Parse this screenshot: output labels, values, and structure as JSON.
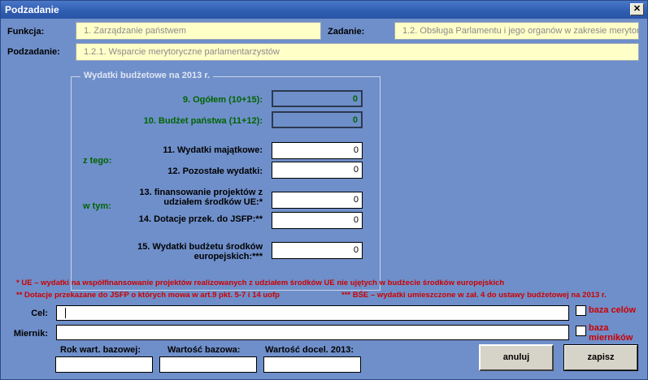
{
  "window": {
    "title": "Podzadanie",
    "close_glyph": "✕"
  },
  "header": {
    "funkcja_label": "Funkcja:",
    "funkcja_value": "1. Zarządzanie państwem",
    "zadanie_label": "Zadanie:",
    "zadanie_value": "1.2. Obsługa Parlamentu i jego organów w zakresie merytor",
    "podzadanie_label": "Podzadanie:",
    "podzadanie_value": "1.2.1. Wsparcie merytoryczne parlamentarzystów"
  },
  "expenses": {
    "frame_title": "Wydatki budżetowe na 2013 r.",
    "ogolem_label": "9. Ogółem (10+15):",
    "ogolem_value": "0",
    "budzet_label": "10. Budżet państwa (11+12):",
    "budzet_value": "0",
    "z_tego_label": "z tego:",
    "majatkowe_label": "11. Wydatki majątkowe:",
    "majatkowe_value": "0",
    "pozostale_label": "12. Pozostałe wydatki:",
    "pozostale_value": "0",
    "w_tym_label": "w tym:",
    "ue_label_1": "13. finansowanie projektów z",
    "ue_label_2": "udziałem środków UE:*",
    "ue_value": "0",
    "jsfp_label": "14. Dotacje przek. do JSFP:**",
    "jsfp_value": "0",
    "bse_label_1": "15. Wydatki budżetu środków",
    "bse_label_2": "europejskich:***",
    "bse_value": "0"
  },
  "notes": {
    "ue": "* UE – wydatki na współfinansowanie projektów realizowanych z udziałem środków UE nie ujętych w budżecie środków europejskich",
    "jsfp": "**  Dotacje przekazane do JSFP o których mowa w art.9 pkt. 5-7 i 14 uofp",
    "bse": "*** BŚE – wydatki umieszczone w zał. 4 do ustawy budżetowej na 2013 r."
  },
  "cel": {
    "label": "Cel:",
    "value": "",
    "baza_label": "baza celów"
  },
  "miernik": {
    "label": "Miernik:",
    "value": "",
    "baza_label_1": "baza",
    "baza_label_2": "mierników"
  },
  "bottom": {
    "rok_label": "Rok wart. bazowej:",
    "wartosc_label": "Wartość bazowa:",
    "docel_label": "Wartość docel. 2013:"
  },
  "buttons": {
    "cancel": "anuluj",
    "save": "zapisz"
  }
}
